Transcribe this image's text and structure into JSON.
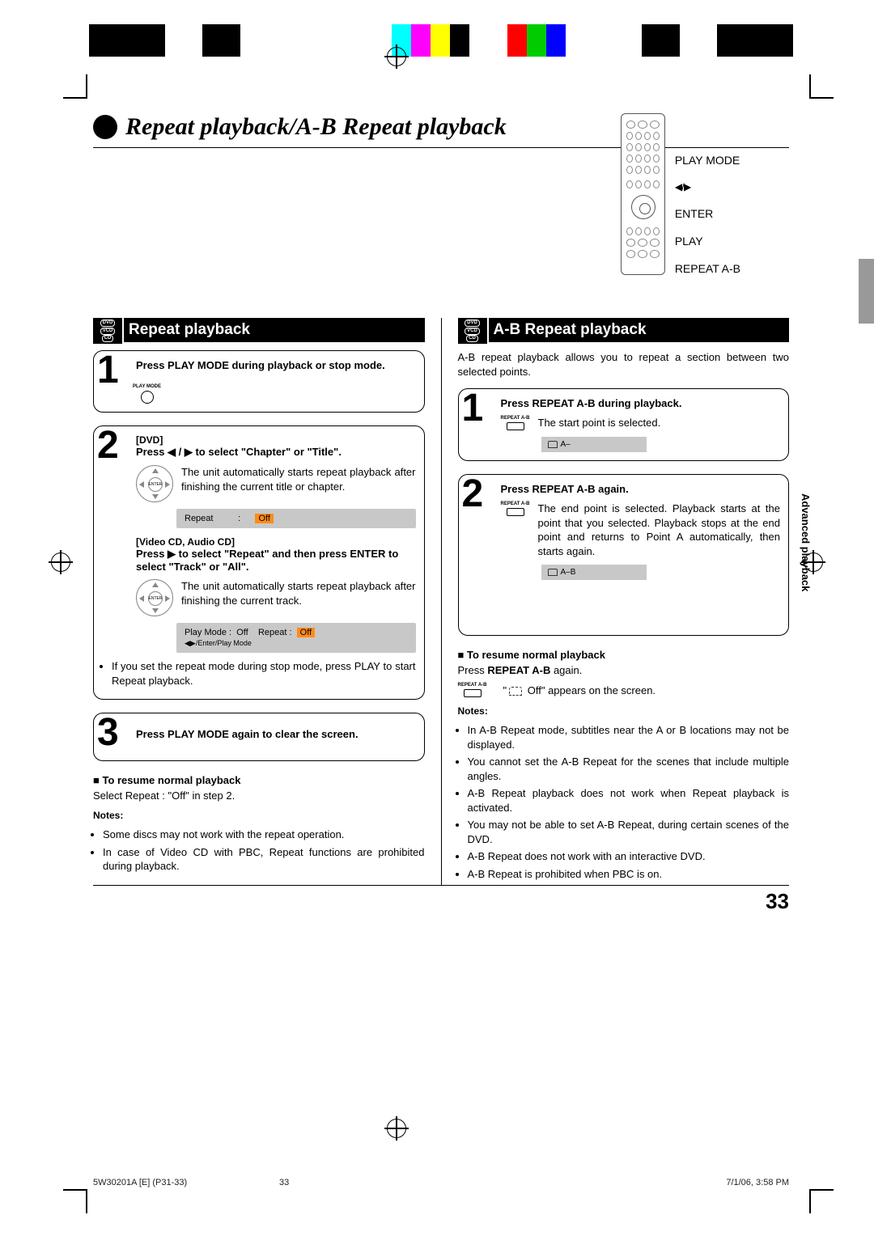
{
  "title": "Repeat playback/A-B Repeat playback",
  "remote_labels": {
    "play_mode": "PLAY MODE",
    "arrows": "◀ / ▶",
    "enter": "ENTER",
    "play": "PLAY",
    "repeat_ab": "REPEAT A-B"
  },
  "disc_badge": {
    "d1": "DVD",
    "d2": "VCD",
    "d3": "CD"
  },
  "left": {
    "header": "Repeat playback",
    "step1": {
      "num": "1",
      "heading": "Press PLAY MODE during playback or stop mode.",
      "icon_label": "PLAY MODE"
    },
    "step2": {
      "num": "2",
      "sub1": "[DVD]",
      "heading1": "Press ◀ / ▶ to select \"Chapter\" or \"Title\".",
      "body1": "The unit automatically starts repeat playback after finishing the current title or chapter.",
      "osd1": {
        "label": "Repeat",
        "colon": ":",
        "value": "Off"
      },
      "sub2": "[Video CD, Audio CD]",
      "heading2": "Press ▶ to select \"Repeat\" and then press ENTER to select \"Track\" or \"All\".",
      "body2": "The unit automatically starts repeat playback after finishing the current track.",
      "nav_label": "ENTER",
      "osd2": {
        "playmode_l": "Play Mode :",
        "playmode_v": "Off",
        "repeat_l": "Repeat :",
        "repeat_v": "Off",
        "hint": "◀▶/Enter/Play Mode"
      },
      "after_bullet": "If you set the repeat mode during stop mode, press PLAY to start Repeat playback."
    },
    "step3": {
      "num": "3",
      "heading": "Press PLAY MODE again to clear the screen."
    },
    "resume_head": "To resume normal playback",
    "resume_body": "Select Repeat : \"Off\" in step 2.",
    "notes_head": "Notes:",
    "notes": [
      "Some discs may not work with the repeat operation.",
      "In case of Video CD with PBC, Repeat functions are prohibited during playback."
    ]
  },
  "right": {
    "header": "A-B Repeat playback",
    "intro": "A-B repeat playback allows you to repeat a section between two selected points.",
    "step1": {
      "num": "1",
      "heading": "Press REPEAT A-B during playback.",
      "icon_label": "REPEAT A-B",
      "body": "The start point is selected.",
      "osd": "A–"
    },
    "step2": {
      "num": "2",
      "heading": "Press REPEAT A-B again.",
      "icon_label": "REPEAT A-B",
      "body": "The end point is selected. Playback starts at the point that you selected. Playback stops at the end point and returns to Point A automatically, then starts again.",
      "osd": "A–B"
    },
    "resume_head": "To resume normal playback",
    "resume_body_pre": "Press ",
    "resume_body_bold": "REPEAT A-B",
    "resume_body_post": " again.",
    "offline_pre": "\"",
    "offline_post": " Off\" appears on the screen.",
    "icon_label_small": "REPEAT A-B",
    "notes_head": "Notes:",
    "notes": [
      "In A-B Repeat mode, subtitles near the A or B locations may not be displayed.",
      "You cannot set the A-B Repeat for the scenes that include multiple angles.",
      "A-B Repeat playback does not work when Repeat playback is activated.",
      "You may not be able to set A-B Repeat, during certain scenes of the DVD.",
      "A-B Repeat does not work with an interactive DVD.",
      "A-B Repeat is prohibited when PBC is on."
    ]
  },
  "side_label": "Advanced playback",
  "page_number": "33",
  "footer": {
    "left": "5W30201A [E] (P31-33)",
    "mid": "33",
    "right": "7/1/06, 3:58 PM"
  }
}
